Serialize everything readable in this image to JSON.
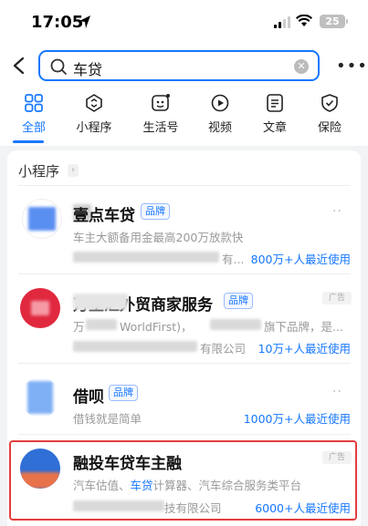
{
  "status_bar": {
    "time": "17:05",
    "battery": "25"
  },
  "search": {
    "query": "车贷"
  },
  "tabs": [
    {
      "label": "全部"
    },
    {
      "label": "小程序"
    },
    {
      "label": "生活号"
    },
    {
      "label": "视频"
    },
    {
      "label": "文章"
    },
    {
      "label": "保险"
    }
  ],
  "section": {
    "title": "小程序"
  },
  "results": [
    {
      "name": "壹点车贷",
      "badge": "品牌",
      "desc": "车主大额备用金最高200万放款快",
      "company_suffix": "有...",
      "users": "800万+人最近使用"
    },
    {
      "name": "万里汇外贸商家服务",
      "badge": "品牌",
      "ad": "广告",
      "desc_a": "万",
      "desc_b": "WorldFirst)，",
      "desc_c": "旗下品牌，是...",
      "company_suffix": "有限公司",
      "users": "10万+人最近使用"
    },
    {
      "name": "借呗",
      "badge": "品牌",
      "desc": "借钱就是简单",
      "users": "1000万+人最近使用"
    },
    {
      "name": "融投车贷车主融",
      "ad": "广告",
      "desc_pre": "汽车估值、",
      "desc_hl": "车贷",
      "desc_post": "计算器、汽车综合服务类平台",
      "company_suffix": "技有限公司",
      "users": "6000+人最近使用"
    }
  ]
}
